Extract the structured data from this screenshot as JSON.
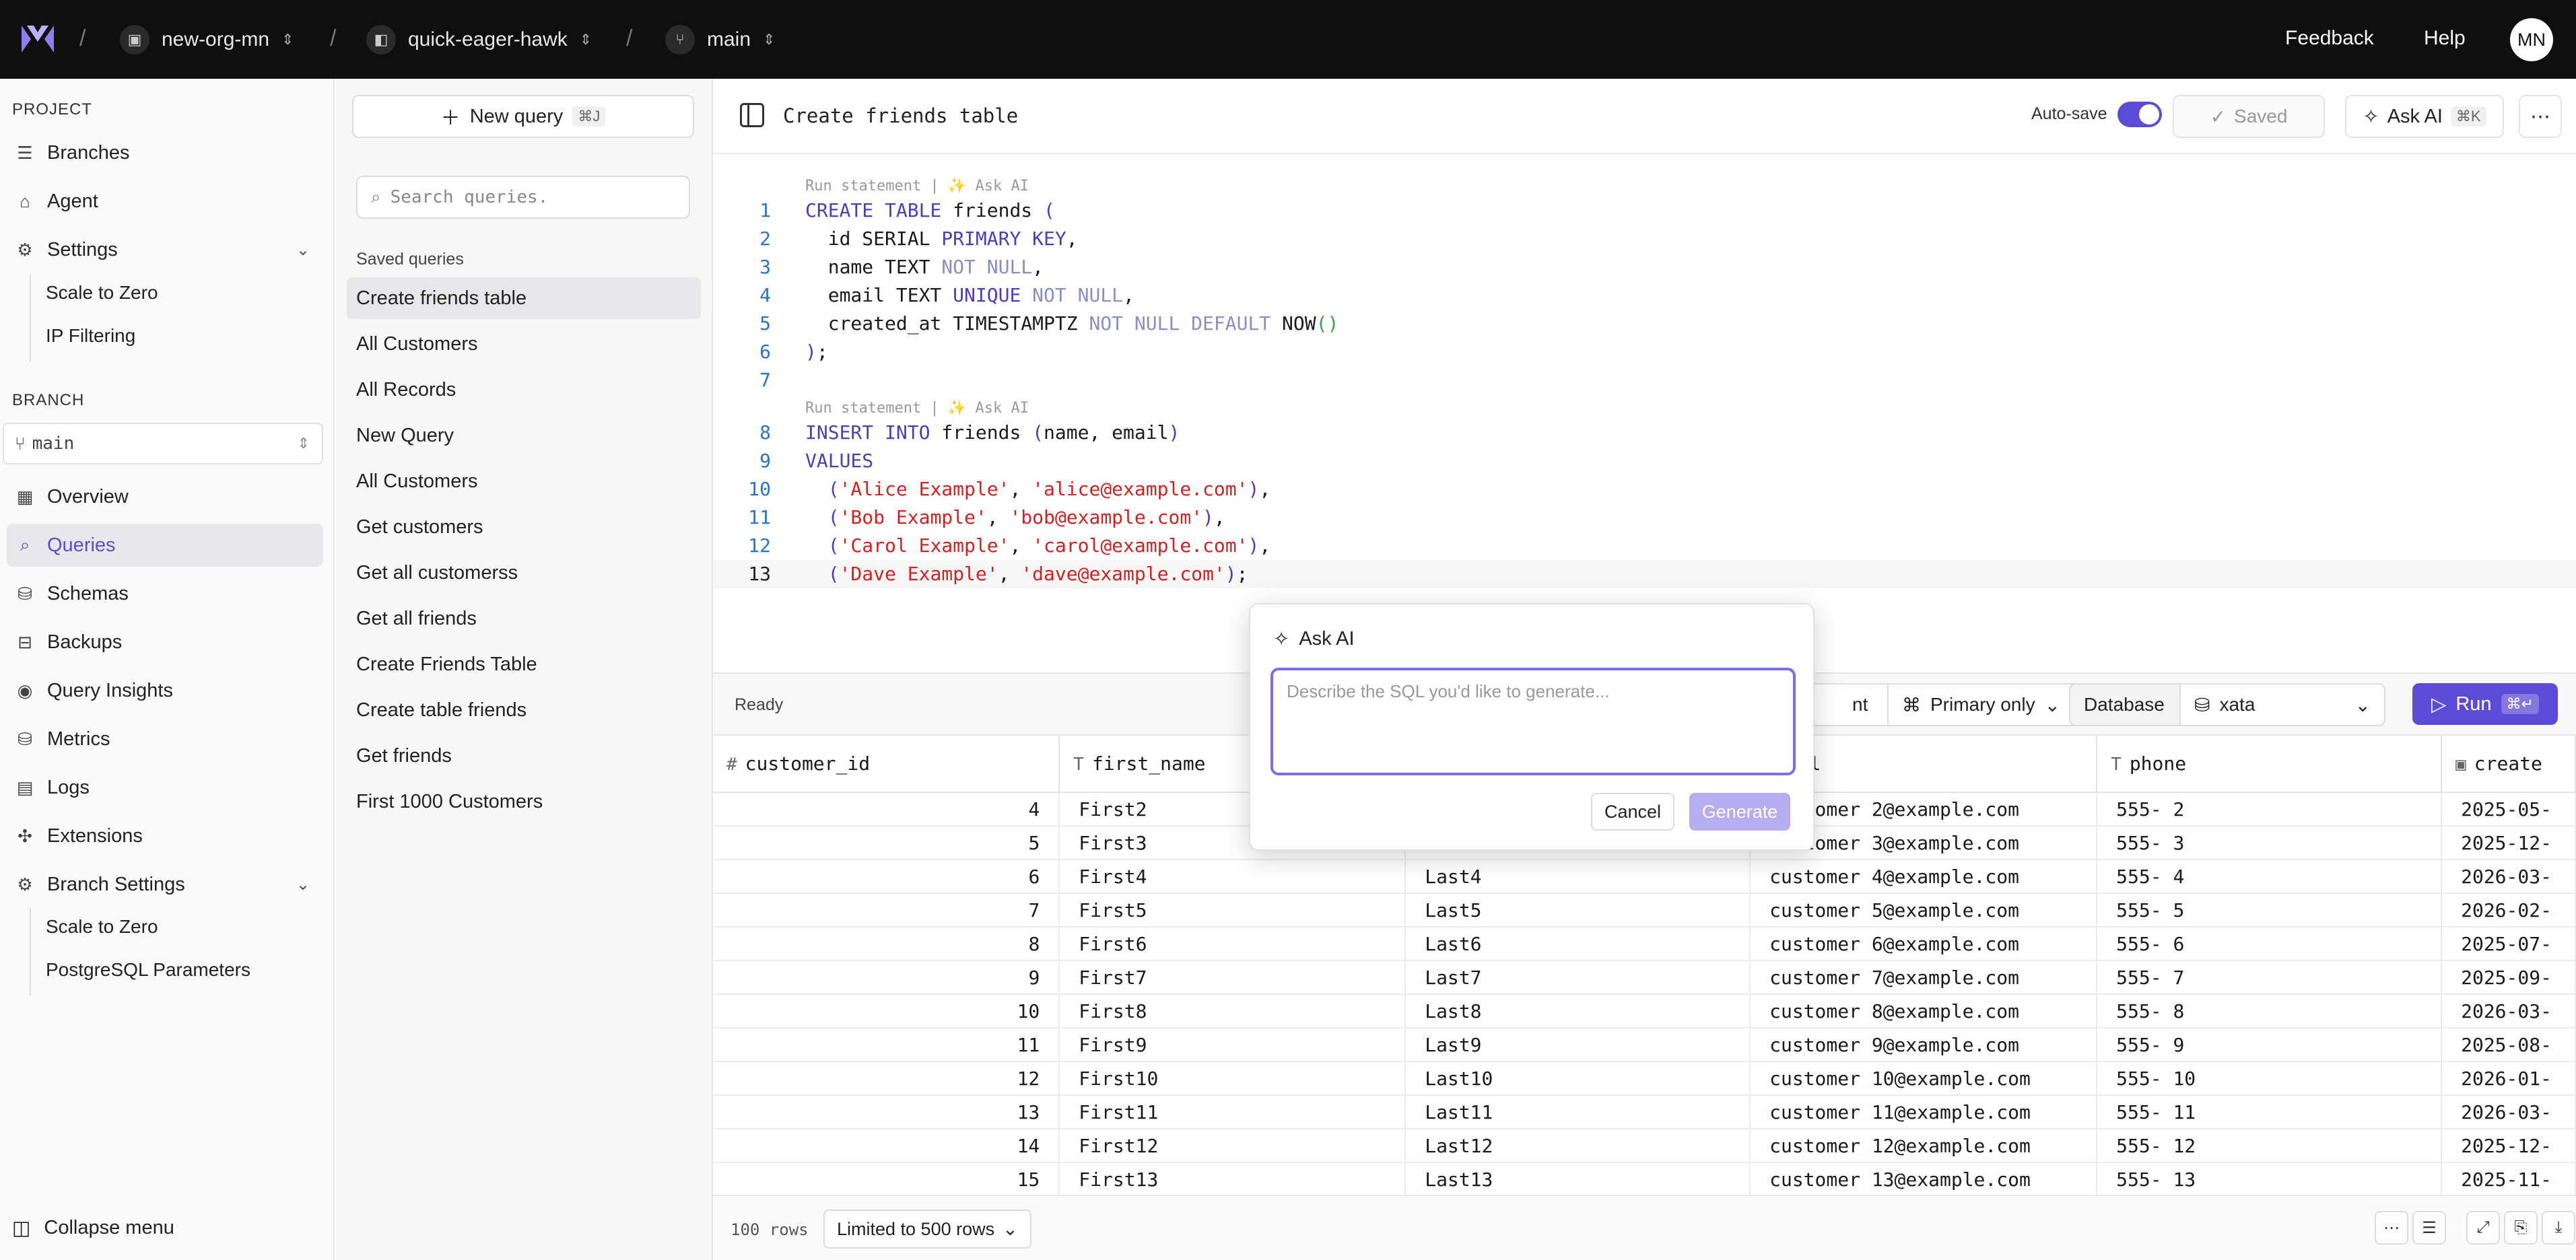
{
  "topbar": {
    "org": "new-org-mn",
    "project": "quick-eager-hawk",
    "branch": "main",
    "feedback": "Feedback",
    "help": "Help",
    "avatar": "MN"
  },
  "nav": {
    "project_label": "PROJECT",
    "branches": "Branches",
    "agent": "Agent",
    "settings": "Settings",
    "scale_to_zero": "Scale to Zero",
    "ip_filtering": "IP Filtering",
    "branch_label": "BRANCH",
    "branch_select": "main",
    "overview": "Overview",
    "queries": "Queries",
    "schemas": "Schemas",
    "backups": "Backups",
    "query_insights": "Query Insights",
    "metrics": "Metrics",
    "logs": "Logs",
    "extensions": "Extensions",
    "branch_settings": "Branch Settings",
    "bs_scale_to_zero": "Scale to Zero",
    "pg_params": "PostgreSQL Parameters",
    "collapse": "Collapse menu"
  },
  "queries": {
    "new_query": "New query",
    "new_query_kbd": "⌘J",
    "search_placeholder": "Search queries.",
    "saved_label": "Saved queries",
    "items": [
      "Create friends table",
      "All Customers",
      "All Records",
      "New Query",
      "All Customers",
      "Get customers",
      "Get all customerss",
      "Get all friends",
      "Create Friends Table",
      "Create table friends",
      "Get friends",
      "First 1000 Customers"
    ]
  },
  "editor": {
    "title": "Create friends table",
    "autosave": "Auto-save",
    "saved": "Saved",
    "ask_ai": "Ask AI",
    "ask_ai_kbd": "⌘K",
    "codelens": "Run statement | ✨ Ask AI"
  },
  "results": {
    "status": "Ready",
    "partial_label": "nt",
    "primary": "Primary only",
    "database_label": "Database",
    "database": "xata",
    "run": "Run",
    "run_kbd": "⌘↵",
    "columns": [
      "customer_id",
      "first_name",
      "",
      "email",
      "phone",
      "create"
    ],
    "rows": [
      [
        "4",
        "First2",
        "",
        "customer 2@example.com",
        "555- 2",
        "2025-05-"
      ],
      [
        "5",
        "First3",
        "",
        "customer 3@example.com",
        "555- 3",
        "2025-12-"
      ],
      [
        "6",
        "First4",
        "Last4",
        "customer 4@example.com",
        "555- 4",
        "2026-03-"
      ],
      [
        "7",
        "First5",
        "Last5",
        "customer 5@example.com",
        "555- 5",
        "2026-02-"
      ],
      [
        "8",
        "First6",
        "Last6",
        "customer 6@example.com",
        "555- 6",
        "2025-07-"
      ],
      [
        "9",
        "First7",
        "Last7",
        "customer 7@example.com",
        "555- 7",
        "2025-09-"
      ],
      [
        "10",
        "First8",
        "Last8",
        "customer 8@example.com",
        "555- 8",
        "2026-03-"
      ],
      [
        "11",
        "First9",
        "Last9",
        "customer 9@example.com",
        "555- 9",
        "2025-08-"
      ],
      [
        "12",
        "First10",
        "Last10",
        "customer 10@example.com",
        "555- 10",
        "2026-01-"
      ],
      [
        "13",
        "First11",
        "Last11",
        "customer 11@example.com",
        "555- 11",
        "2026-03-"
      ],
      [
        "14",
        "First12",
        "Last12",
        "customer 12@example.com",
        "555- 12",
        "2025-12-"
      ],
      [
        "15",
        "First13",
        "Last13",
        "customer 13@example.com",
        "555- 13",
        "2025-11-"
      ]
    ],
    "row_count": "100 rows",
    "limit": "Limited to 500 rows"
  },
  "ask_ai_popup": {
    "title": "Ask AI",
    "placeholder": "Describe the SQL you'd like to generate...",
    "cancel": "Cancel",
    "generate": "Generate"
  },
  "colors": {
    "accent": "#5b4bd6",
    "topbar": "#0f0f0f"
  }
}
